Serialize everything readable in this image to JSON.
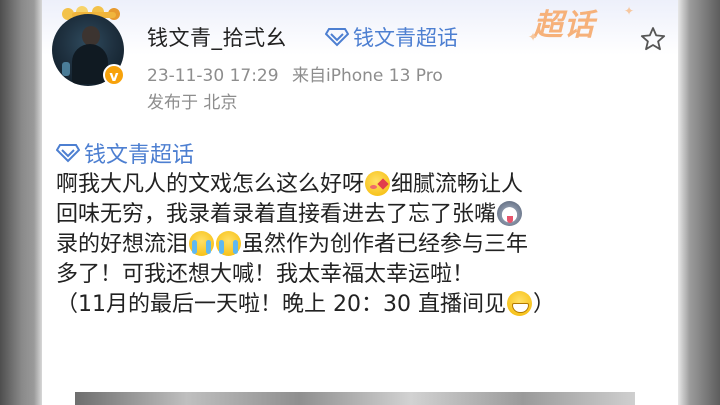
{
  "header": {
    "username": "钱文青_拾弍幺",
    "topic_link": "钱文青超话",
    "timestamp": "23-11-30 17:29",
    "source": "来自iPhone 13 Pro",
    "location": "发布于 北京",
    "banner": "超话",
    "verified_badge": "v"
  },
  "post": {
    "topic": "钱文青超话",
    "lines": [
      {
        "a": "啊我大凡人的文戏怎么这么好呀",
        "b": "细腻流畅让人"
      },
      {
        "a": "回味无穷，我录着录着直接看进去了忘了张嘴"
      },
      {
        "a": "录的好想流泪",
        "b": "虽然作为创作者已经参与三年"
      },
      {
        "a": "多了！可我还想大喊！我太幸福太幸运啦！"
      },
      {
        "a": "（11月的最后一天啦！晚上 20：30 直播间见",
        "b": "）"
      }
    ]
  },
  "icons": {
    "diamond": "supertopic-diamond-icon",
    "star": "star-outline-icon",
    "emojis": [
      "kiss-face-emoji",
      "husky-face-emoji",
      "crying-face-emoji",
      "crying-face-emoji",
      "grin-face-emoji"
    ]
  },
  "colors": {
    "link": "#4d7fd1",
    "meta": "#8d8d8d",
    "banner": "#f6b17a",
    "verified": "#f7a20b"
  }
}
